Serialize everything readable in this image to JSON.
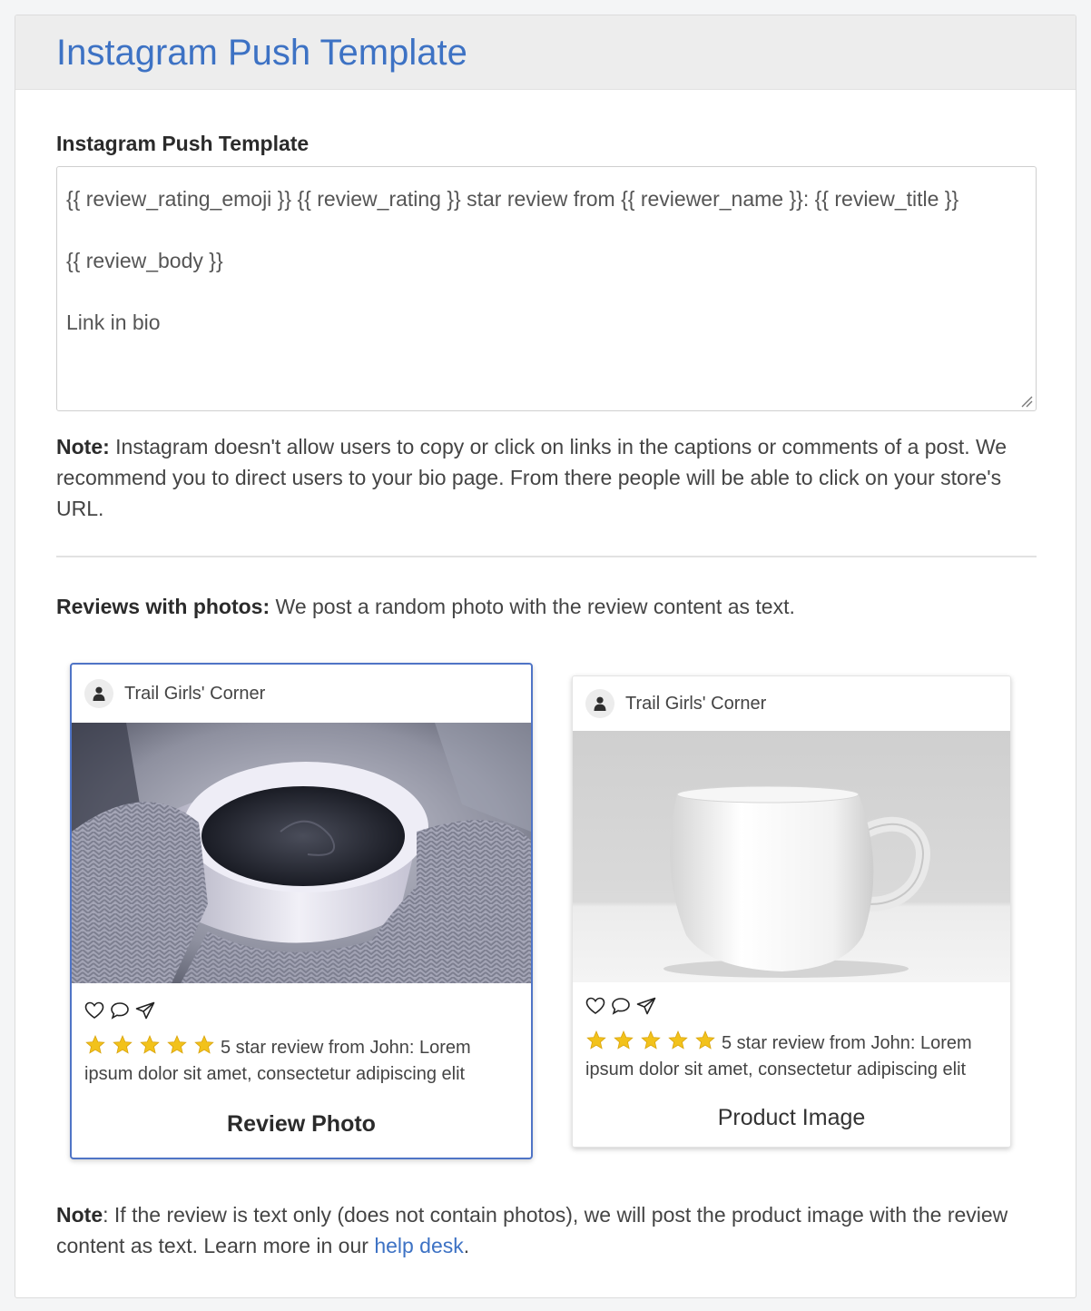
{
  "header": {
    "title": "Instagram Push Template"
  },
  "template": {
    "label": "Instagram Push Template",
    "lines": [
      "{{ review_rating_emoji }} {{ review_rating }} star review from {{ reviewer_name }}: {{ review_title }}",
      "{{ review_body }}",
      "Link in bio"
    ]
  },
  "note": {
    "prefix": "Note:",
    "text": " Instagram doesn't allow users to copy or click on links in the captions or comments of a post. We recommend you to direct users to your bio page. From there people will be able to click on your store's URL."
  },
  "photos_info": {
    "prefix": "Reviews with photos:",
    "text": " We post a random photo with the review content as text."
  },
  "cards": [
    {
      "account": "Trail Girls' Corner",
      "caption": "5 star review from John: Lorem ipsum dolor sit amet, consectetur adipiscing elit",
      "label": "Review Photo",
      "selected": true
    },
    {
      "account": "Trail Girls' Corner",
      "caption": "5 star review from John: Lorem ipsum dolor sit amet, consectetur adipiscing elit",
      "label": "Product Image",
      "selected": false
    }
  ],
  "review_stars": 5,
  "bottom_note": {
    "prefix": "Note",
    "text": ": If the review is text only (does not contain photos), we will post the product image with the review content as text. Learn more in our ",
    "link": "help desk",
    "suffix": "."
  },
  "colors": {
    "accent": "#3d72c4",
    "selected_border": "#4f74c6",
    "star": "#f2c21b"
  },
  "icons": [
    "user-icon",
    "heart-icon",
    "comment-icon",
    "send-icon",
    "star-icon",
    "resize-grip-icon"
  ]
}
